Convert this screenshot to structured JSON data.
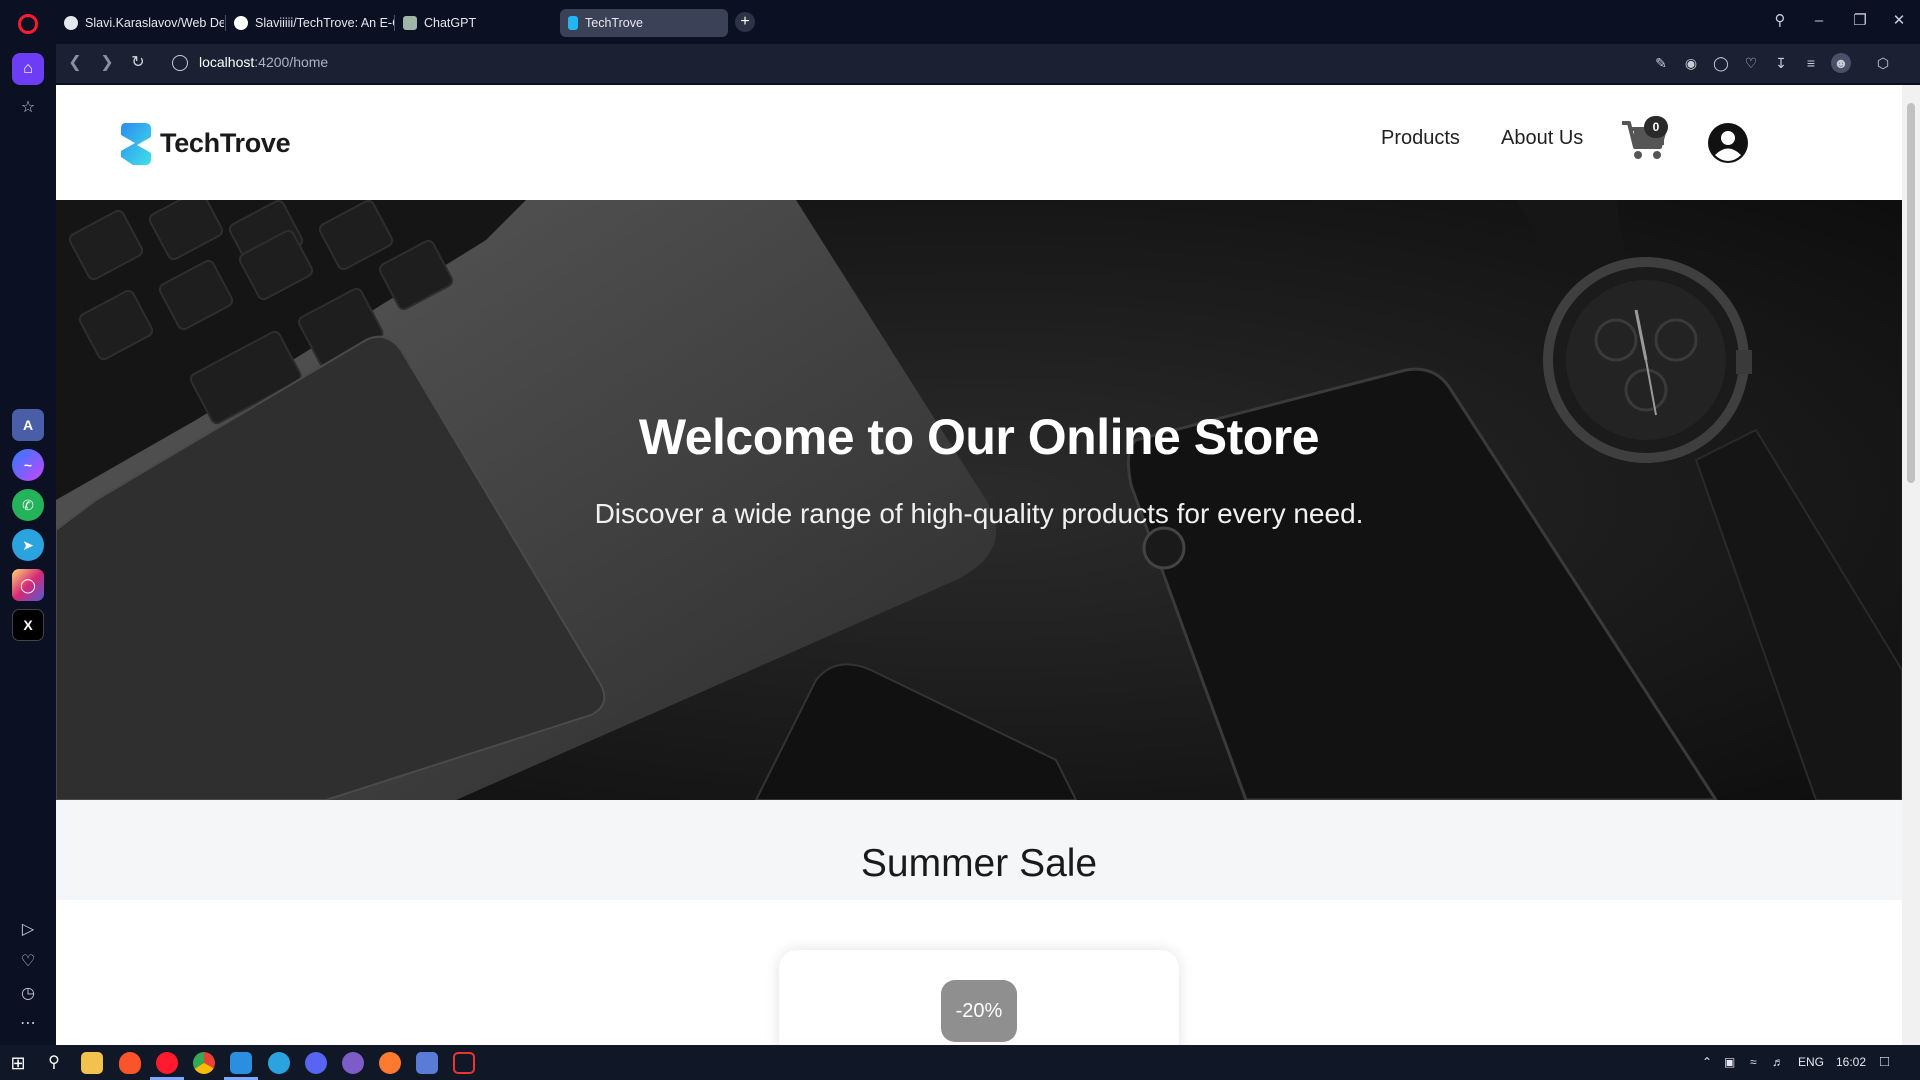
{
  "browser": {
    "tabs": [
      {
        "label": "Slavi.Karaslavov/Web Dev",
        "active": false
      },
      {
        "label": "Slaviiiii/TechTrove: An E-C",
        "active": false
      },
      {
        "label": "ChatGPT",
        "active": false
      },
      {
        "label": "TechTrove",
        "active": true
      }
    ],
    "url_host": "localhost",
    "url_path": ":4200/home"
  },
  "site": {
    "brand": "TechTrove",
    "nav": {
      "products": "Products",
      "about": "About Us"
    },
    "cart_count": "0"
  },
  "hero": {
    "title": "Welcome to Our Online Store",
    "subtitle": "Discover a wide range of high-quality products for every need."
  },
  "sale": {
    "title": "Summer Sale",
    "discount": "-20%"
  },
  "taskbar": {
    "language": "ENG",
    "time": "16:02"
  },
  "colors": {
    "accent": "#6f3cf5",
    "opera_red": "#ff1b2d",
    "logo_blue": "#22b6f2"
  }
}
